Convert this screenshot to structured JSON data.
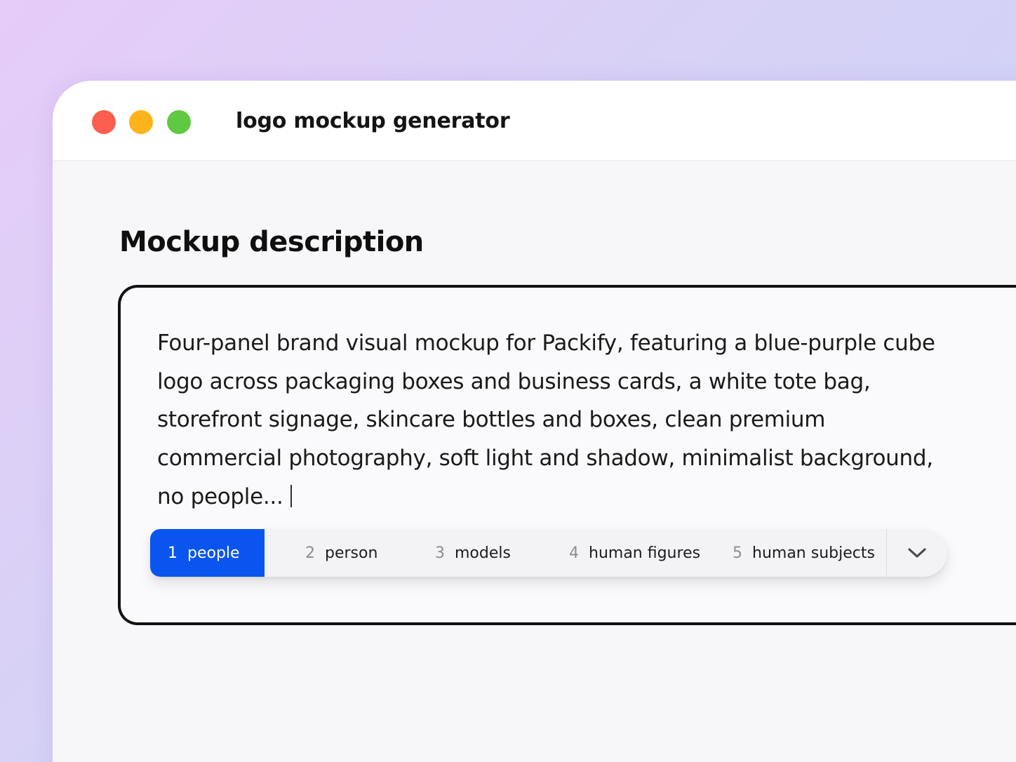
{
  "window": {
    "title": "logo mockup generator",
    "controls": {
      "close_color": "#fe5e4f",
      "minimize_color": "#fdb31a",
      "maximize_color": "#5ec941"
    }
  },
  "main": {
    "section_title": "Mockup description",
    "description": "Four-panel brand visual mockup for Packify, featuring a blue-purple cube\nlogo across packaging boxes and business cards, a white tote bag,\nstorefront signage, skincare bottles and boxes, clean premium\ncommercial photography, soft light and shadow, minimalist background,\nno people...",
    "suggestions": [
      {
        "index": "1",
        "label": "people",
        "selected": true
      },
      {
        "index": "2",
        "label": "person",
        "selected": false
      },
      {
        "index": "3",
        "label": "models",
        "selected": false
      },
      {
        "index": "4",
        "label": "human figures",
        "selected": false
      },
      {
        "index": "5",
        "label": "human subjects",
        "selected": false
      }
    ],
    "expand_icon": "chevron-down-icon"
  },
  "colors": {
    "accent": "#0a55f0"
  }
}
